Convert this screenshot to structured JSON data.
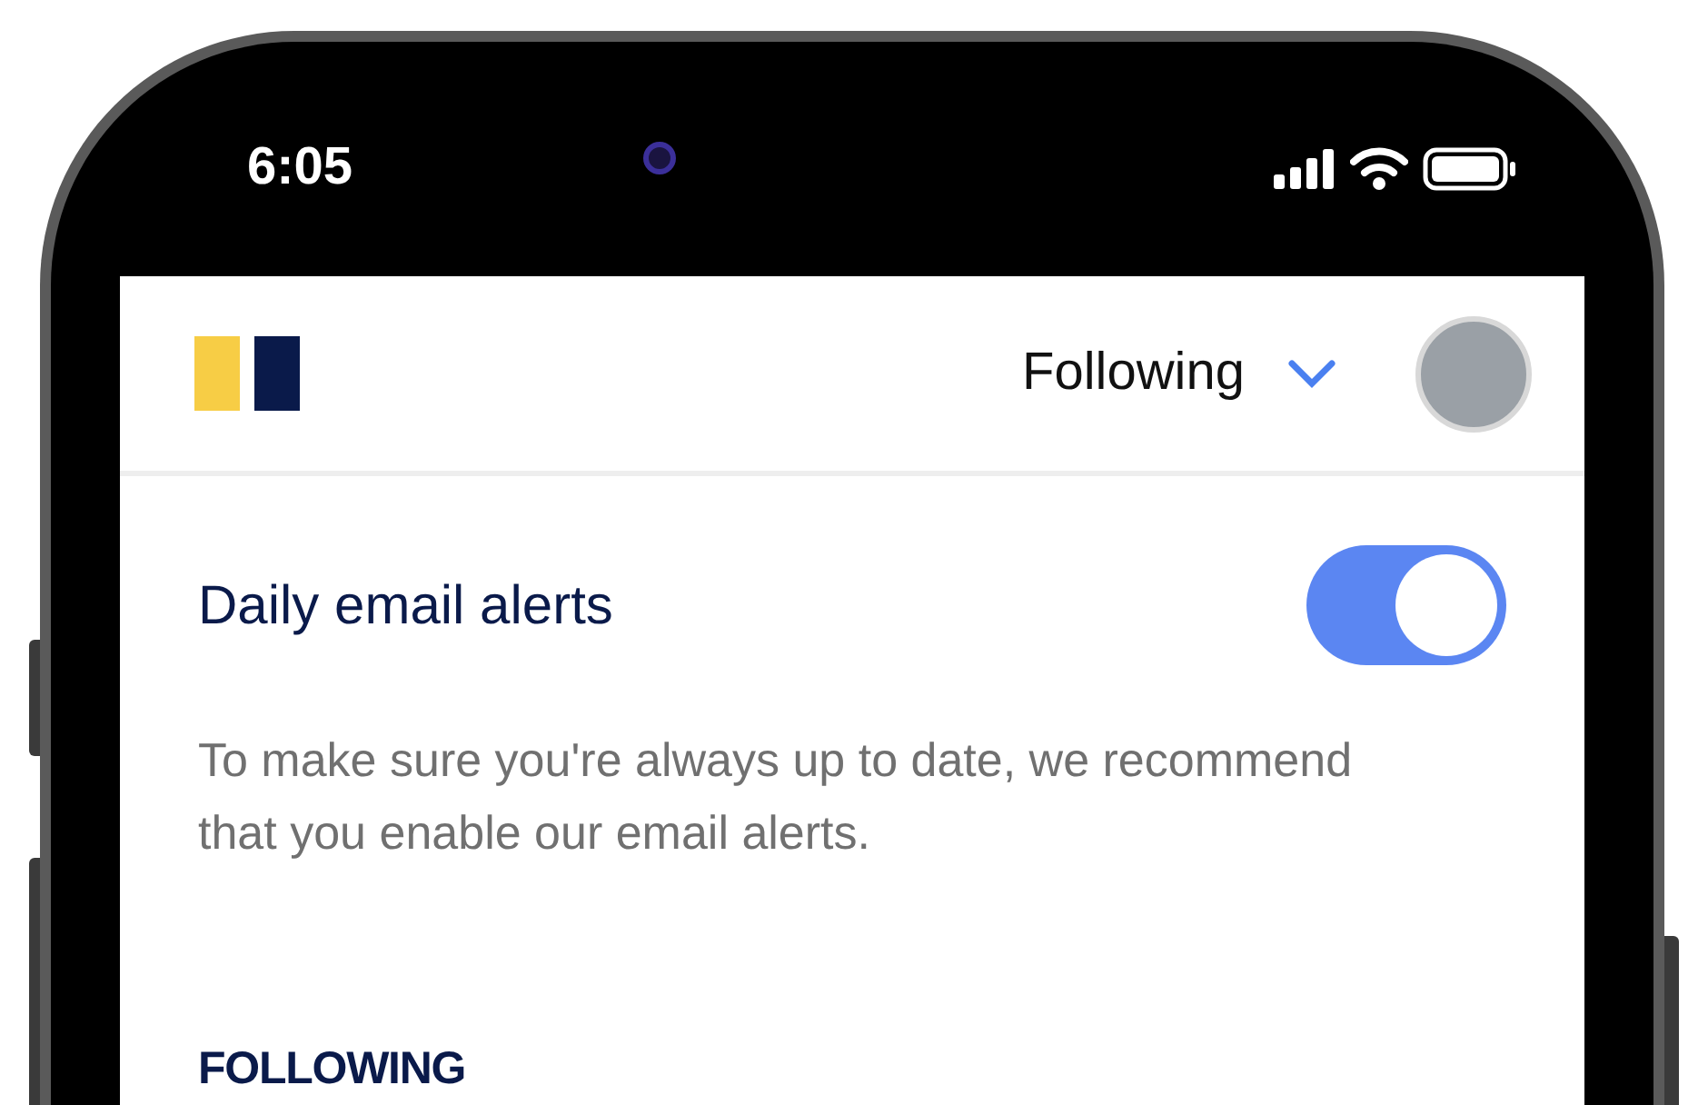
{
  "status_bar": {
    "time": "6:05"
  },
  "header": {
    "filter": "Following"
  },
  "alerts": {
    "title": "Daily email alerts",
    "enabled": true,
    "description": "To make sure you're always up to date, we recommend that you enable our email alerts."
  },
  "section_heading": "FOLLOWING"
}
